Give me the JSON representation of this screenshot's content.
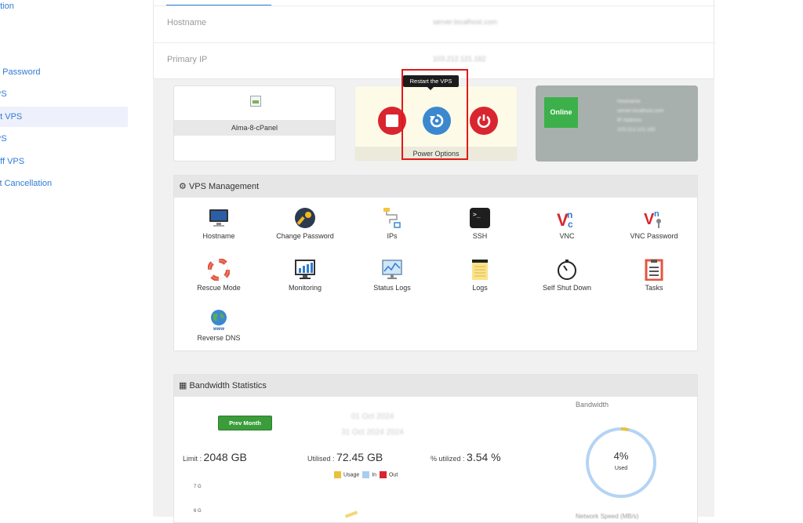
{
  "sidebar": {
    "items": [
      {
        "label": "ation"
      },
      {
        "label": "e Password"
      },
      {
        "label": "PS"
      },
      {
        "label": "ot VPS"
      },
      {
        "label": "PS"
      },
      {
        "label": "off VPS"
      },
      {
        "label": "st Cancellation"
      }
    ]
  },
  "info": {
    "hostname_label": "Hostname",
    "hostname_value": "server.localhost.com",
    "ip_label": "Primary IP",
    "ip_value": "103.212.121.162"
  },
  "os_card": {
    "name": "Alma-8-cPanel"
  },
  "power": {
    "tooltip": "Restart the VPS",
    "label": "Power Options"
  },
  "status": {
    "badge": "Online",
    "lines": [
      "Hostname",
      "server.localhost.com",
      "IP Address",
      "103.212.121.162"
    ]
  },
  "management": {
    "title": "VPS Management",
    "tiles": [
      {
        "label": "Hostname",
        "icon": "monitor-icon"
      },
      {
        "label": "Change Password",
        "icon": "key-icon"
      },
      {
        "label": "IPs",
        "icon": "network-icon"
      },
      {
        "label": "SSH",
        "icon": "terminal-icon"
      },
      {
        "label": "VNC",
        "icon": "vnc-icon"
      },
      {
        "label": "VNC Password",
        "icon": "vnc-key-icon"
      },
      {
        "label": "Rescue Mode",
        "icon": "lifebuoy-icon"
      },
      {
        "label": "Monitoring",
        "icon": "chart-monitor-icon"
      },
      {
        "label": "Status Logs",
        "icon": "status-monitor-icon"
      },
      {
        "label": "Logs",
        "icon": "notepad-icon"
      },
      {
        "label": "Self Shut Down",
        "icon": "timer-icon"
      },
      {
        "label": "Tasks",
        "icon": "tasks-icon"
      },
      {
        "label": "Reverse DNS",
        "icon": "globe-icon"
      }
    ]
  },
  "bandwidth": {
    "title": "Bandwidth Statistics",
    "prev_button": "Prev Month",
    "date_range": [
      "01 Oct 2024",
      "31 Oct 2024 2024"
    ],
    "limit_label": "Limit :",
    "limit_value": "2048 GB",
    "utilised_label": "Utilised :",
    "utilised_value": "72.45 GB",
    "percent_label": "% utilized :",
    "percent_value": "3.54 %",
    "legend": [
      {
        "name": "Usage",
        "color": "#e8c23a"
      },
      {
        "name": "In",
        "color": "#a9cdf0"
      },
      {
        "name": "Out",
        "color": "#d9252f"
      }
    ],
    "y_ticks": [
      "7 G",
      "6 G"
    ],
    "donut_title": "Bandwidth",
    "donut_percent": "4%",
    "donut_used": "Used",
    "donut_fraction": 0.0354,
    "network_label": "Network Speed (MB/s)"
  },
  "colors": {
    "accent": "#2f7ad6",
    "danger": "#d9252f",
    "success": "#3cb04a"
  }
}
